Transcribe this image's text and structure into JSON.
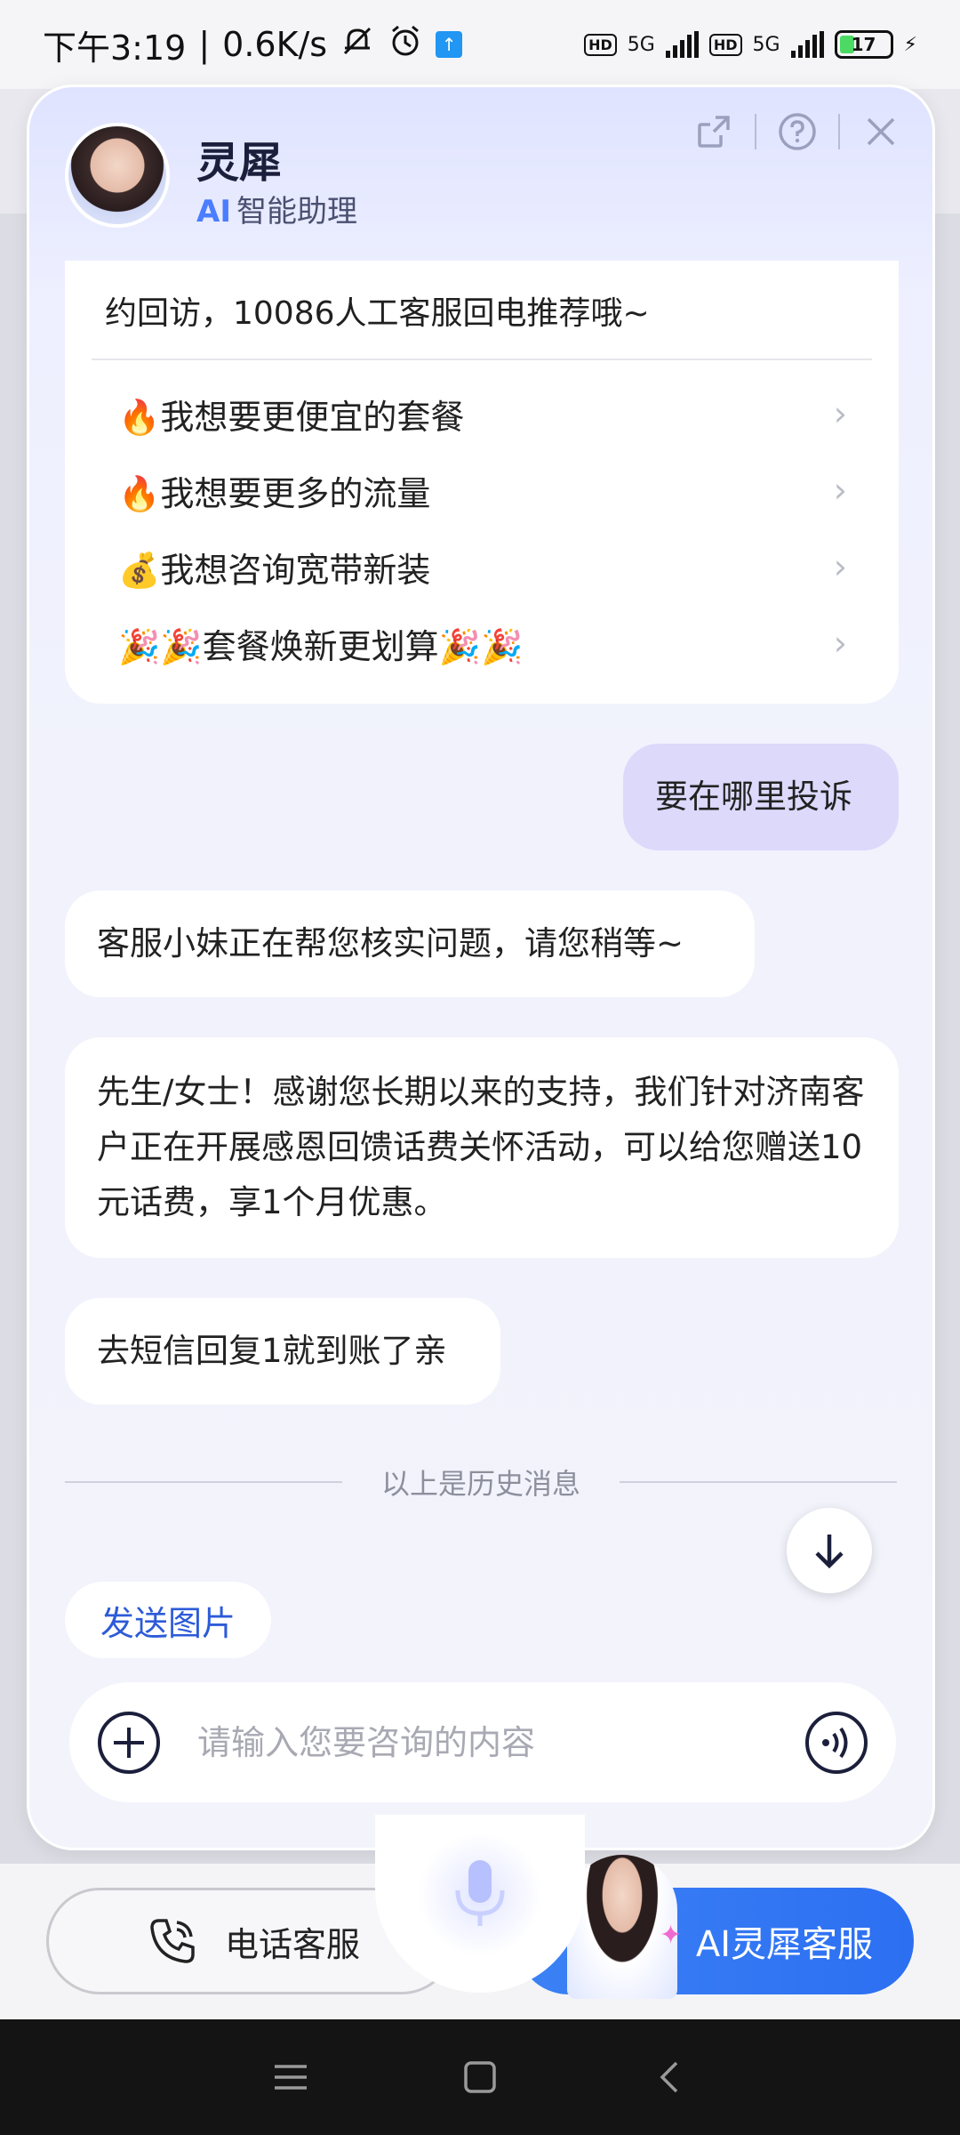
{
  "status_bar": {
    "time": "下午3:19",
    "speed": "0.6K/s",
    "hd1": "HD",
    "net1": "5G",
    "hd2": "HD",
    "net2": "5G",
    "battery": "17"
  },
  "header": {
    "title": "灵犀",
    "subtitle_ai": "AI",
    "subtitle": "智能助理",
    "icons": [
      "share-icon",
      "help-icon",
      "close-icon"
    ]
  },
  "chat": {
    "card_top_text": "约回访，10086人工客服回电推荐哦~",
    "quick_items": [
      {
        "emoji": "🔥",
        "label": "我想要更便宜的套餐"
      },
      {
        "emoji": "🔥",
        "label": "我想要更多的流量"
      },
      {
        "emoji": "💰",
        "label": "我想咨询宽带新装"
      },
      {
        "emoji": "🎉🎉",
        "label": "套餐焕新更划算🎉🎉"
      }
    ],
    "user_message": "要在哪里投诉",
    "bot_messages": [
      "客服小妹正在帮您核实问题，请您稍等~",
      "先生/女士！感谢您长期以来的支持，我们针对济南客户正在开展感恩回馈话费关怀活动，可以给您赠送10元话费，享1个月优惠。",
      "去短信回复1就到账了亲"
    ],
    "history_divider": "以上是历史消息"
  },
  "composer": {
    "send_image_label": "发送图片",
    "placeholder": "请输入您要咨询的内容"
  },
  "bottom": {
    "phone_label": "电话客服",
    "ai_label": "AI灵犀客服"
  },
  "colors": {
    "accent": "#2c6ff2",
    "user_bubble": "#dcd9fb",
    "link": "#2d5bd8"
  }
}
